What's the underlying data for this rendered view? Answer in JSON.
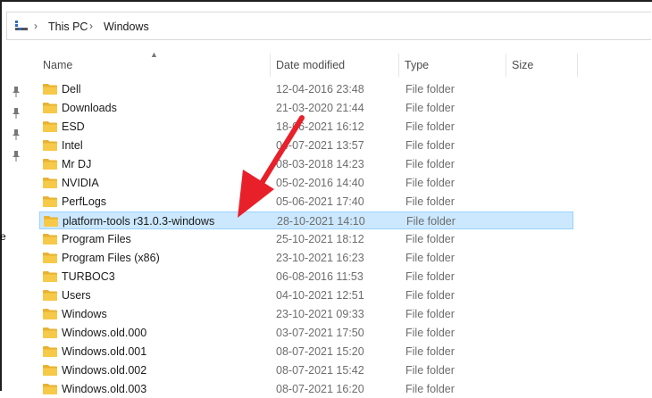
{
  "address": {
    "crumbs": [
      "This PC",
      "Windows"
    ],
    "icon": "this-pc-icon"
  },
  "sidebar": {
    "edge_text": "e"
  },
  "columns": {
    "name": "Name",
    "date": "Date modified",
    "type": "Type",
    "size": "Size"
  },
  "rows": [
    {
      "name": "Dell",
      "date": "12-04-2016 23:48",
      "type": "File folder"
    },
    {
      "name": "Downloads",
      "date": "21-03-2020 21:44",
      "type": "File folder"
    },
    {
      "name": "ESD",
      "date": "18-06-2021 16:12",
      "type": "File folder"
    },
    {
      "name": "Intel",
      "date": "04-07-2021 13:57",
      "type": "File folder"
    },
    {
      "name": "Mr DJ",
      "date": "08-03-2018 14:23",
      "type": "File folder"
    },
    {
      "name": "NVIDIA",
      "date": "05-02-2016 14:40",
      "type": "File folder"
    },
    {
      "name": "PerfLogs",
      "date": "05-06-2021 17:40",
      "type": "File folder"
    },
    {
      "name": "platform-tools r31.0.3-windows",
      "date": "28-10-2021 14:10",
      "type": "File folder",
      "selected": true
    },
    {
      "name": "Program Files",
      "date": "25-10-2021 18:12",
      "type": "File folder"
    },
    {
      "name": "Program Files (x86)",
      "date": "23-10-2021 16:23",
      "type": "File folder"
    },
    {
      "name": "TURBOC3",
      "date": "06-08-2016 11:53",
      "type": "File folder"
    },
    {
      "name": "Users",
      "date": "04-10-2021 12:51",
      "type": "File folder"
    },
    {
      "name": "Windows",
      "date": "23-10-2021 09:33",
      "type": "File folder"
    },
    {
      "name": "Windows.old.000",
      "date": "03-07-2021 17:50",
      "type": "File folder"
    },
    {
      "name": "Windows.old.001",
      "date": "08-07-2021 15:20",
      "type": "File folder"
    },
    {
      "name": "Windows.old.002",
      "date": "08-07-2021 15:42",
      "type": "File folder"
    },
    {
      "name": "Windows.old.003",
      "date": "08-07-2021 16:20",
      "type": "File folder"
    }
  ],
  "colors": {
    "selection_bg": "#cce8ff",
    "selection_border": "#99d1ff",
    "folder": "#f7c948",
    "annotation_arrow": "#e8202a"
  }
}
